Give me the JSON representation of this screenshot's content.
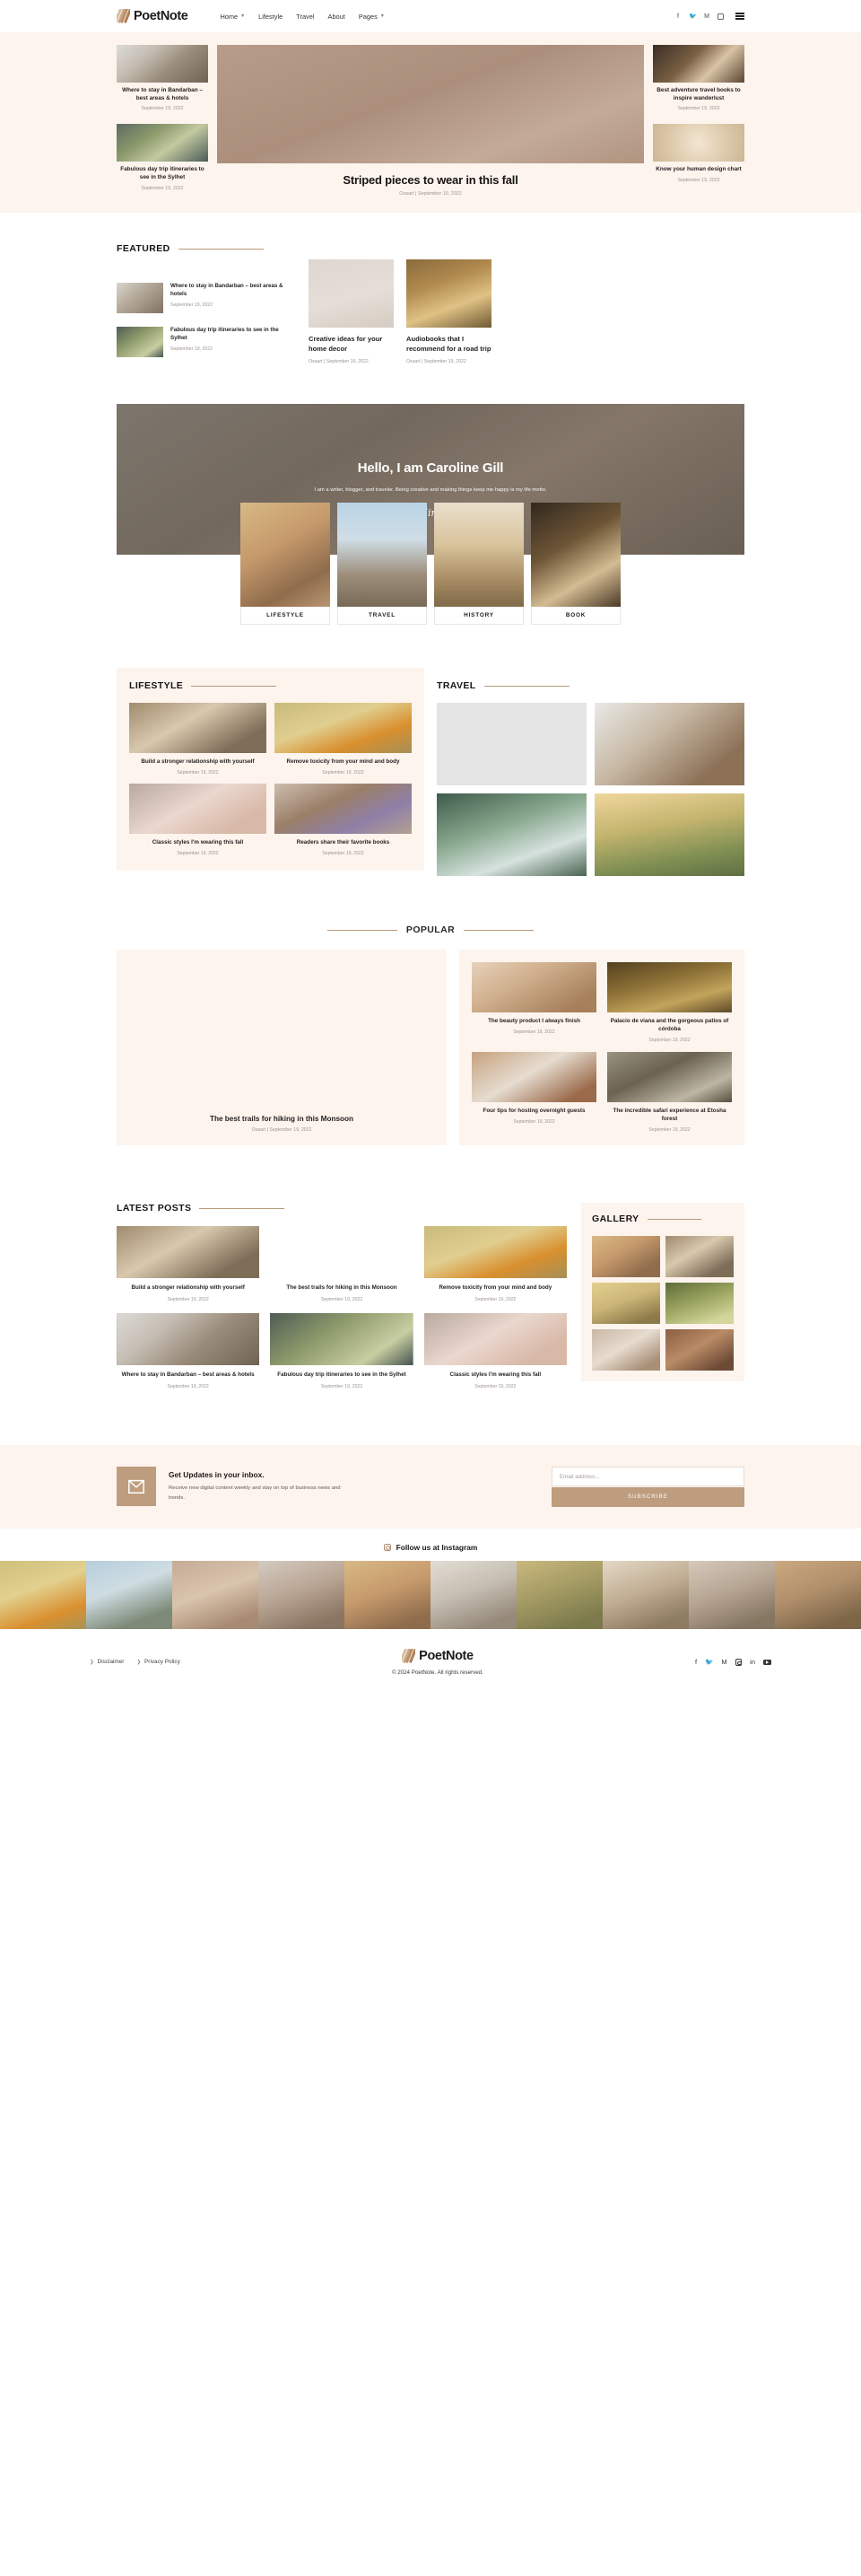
{
  "site": {
    "brand": "PoetNote"
  },
  "header": {
    "nav": [
      {
        "label": "Home",
        "has_caret": true
      },
      {
        "label": "Lifestyle",
        "has_caret": false
      },
      {
        "label": "Travel",
        "has_caret": false
      },
      {
        "label": "About",
        "has_caret": false
      },
      {
        "label": "Pages",
        "has_caret": true
      }
    ],
    "socials": [
      "facebook-icon",
      "twitter-icon",
      "medium-icon",
      "instagram-icon"
    ],
    "menu_icon": "hamburger-menu-icon"
  },
  "hero": {
    "left_cards": [
      {
        "title": "Where to stay in Bandarban – best areas & hotels",
        "date": "September 19, 2022"
      },
      {
        "title": "Fabulous day trip itineraries to see in the Sylhet",
        "date": "September 19, 2022"
      }
    ],
    "main": {
      "title": "Striped pieces to wear in this fall",
      "meta": "Oxaart | September 19, 2022"
    },
    "right_cards": [
      {
        "title": "Best adventure travel books to inspire wanderlust",
        "date": "September 19, 2022"
      },
      {
        "title": "Know your human design chart",
        "date": "September 19, 2022"
      }
    ]
  },
  "featured": {
    "heading": "FEATURED",
    "list": [
      {
        "title": "Where to stay in Bandarban – best areas & hotels",
        "date": "September 19, 2022"
      },
      {
        "title": "Fabulous day trip itineraries to see in the Sylhet",
        "date": "September 19, 2022"
      }
    ],
    "cards": [
      {
        "title": "Creative ideas for your home decor",
        "meta": "Oxaart | September 19, 2022"
      },
      {
        "title": "Audiobooks that I recommend for a road trip",
        "meta": "Oxaart | September 19, 2022"
      }
    ]
  },
  "author": {
    "title": "Hello, I am Caroline Gill",
    "desc": "I am a writer, blogger, and traveler. Being creative and making things keep me happy is my life motto.",
    "signature": "CarolineGill",
    "categories": [
      {
        "label": "LIFESTYLE"
      },
      {
        "label": "TRAVEL"
      },
      {
        "label": "HISTORY"
      },
      {
        "label": "BOOK"
      }
    ]
  },
  "lifestyle": {
    "heading": "LIFESTYLE",
    "posts": [
      {
        "title": "Build a stronger relationship with yourself",
        "date": "September 19, 2022"
      },
      {
        "title": "Remove toxicity from your mind and body",
        "date": "September 19, 2022"
      },
      {
        "title": "Classic styles I'm wearing this fall",
        "date": "September 19, 2022"
      },
      {
        "title": "Readers share their favorite books",
        "date": "September 19, 2022"
      }
    ]
  },
  "travel": {
    "heading": "TRAVEL"
  },
  "popular": {
    "heading": "POPULAR",
    "feature": {
      "title": "The best trails for hiking in this Monsoon",
      "meta": "Oxaart | September 19, 2022"
    },
    "posts": [
      {
        "title": "The beauty product I always finish",
        "date": "September 19, 2022"
      },
      {
        "title": "Palacio de viana and the gorgeous patios of córdoba",
        "date": "September 19, 2022"
      },
      {
        "title": "Four tips for hosting overnight guests",
        "date": "September 19, 2022"
      },
      {
        "title": "The incredible safari experience at Etosha forest",
        "date": "September 19, 2022"
      }
    ]
  },
  "latest": {
    "heading": "LATEST POSTS",
    "posts": [
      {
        "title": "Build a stronger relationship with yourself",
        "date": "September 19, 2022"
      },
      {
        "title": "The best trails for hiking in this Monsoon",
        "date": "September 19, 2022"
      },
      {
        "title": "Remove toxicity from your mind and body",
        "date": "September 19, 2022"
      },
      {
        "title": "Where to stay in Bandarban – best areas & hotels",
        "date": "September 19, 2022"
      },
      {
        "title": "Fabulous day trip itineraries to see in the Sylhet",
        "date": "September 19, 2022"
      },
      {
        "title": "Classic styles I'm wearing this fall",
        "date": "September 19, 2022"
      }
    ]
  },
  "gallery": {
    "heading": "GALLERY"
  },
  "newsletter": {
    "title": "Get Updates in your inbox.",
    "desc": "Receive new digital content weekly and stay on top of business news and trends.",
    "placeholder": "Email address...",
    "button": "SUBSCRIBE",
    "icon": "envelope-icon"
  },
  "instagram": {
    "title": "Follow us at Instagram",
    "icon": "instagram-icon"
  },
  "footer": {
    "links": [
      {
        "label": "Disclaimer"
      },
      {
        "label": "Privacy Policy"
      }
    ],
    "brand": "PoetNote",
    "copyright": "© 2024 PoetNote. All rights reserved.",
    "socials": [
      "facebook-icon",
      "twitter-icon",
      "medium-icon",
      "instagram-icon",
      "linkedin-icon",
      "youtube-icon"
    ]
  },
  "colors": {
    "accent": "#bd9d7e",
    "cream": "#fdf4ee",
    "line": "#b79a7b",
    "text": "#231f1e",
    "muted": "#9d948f"
  }
}
